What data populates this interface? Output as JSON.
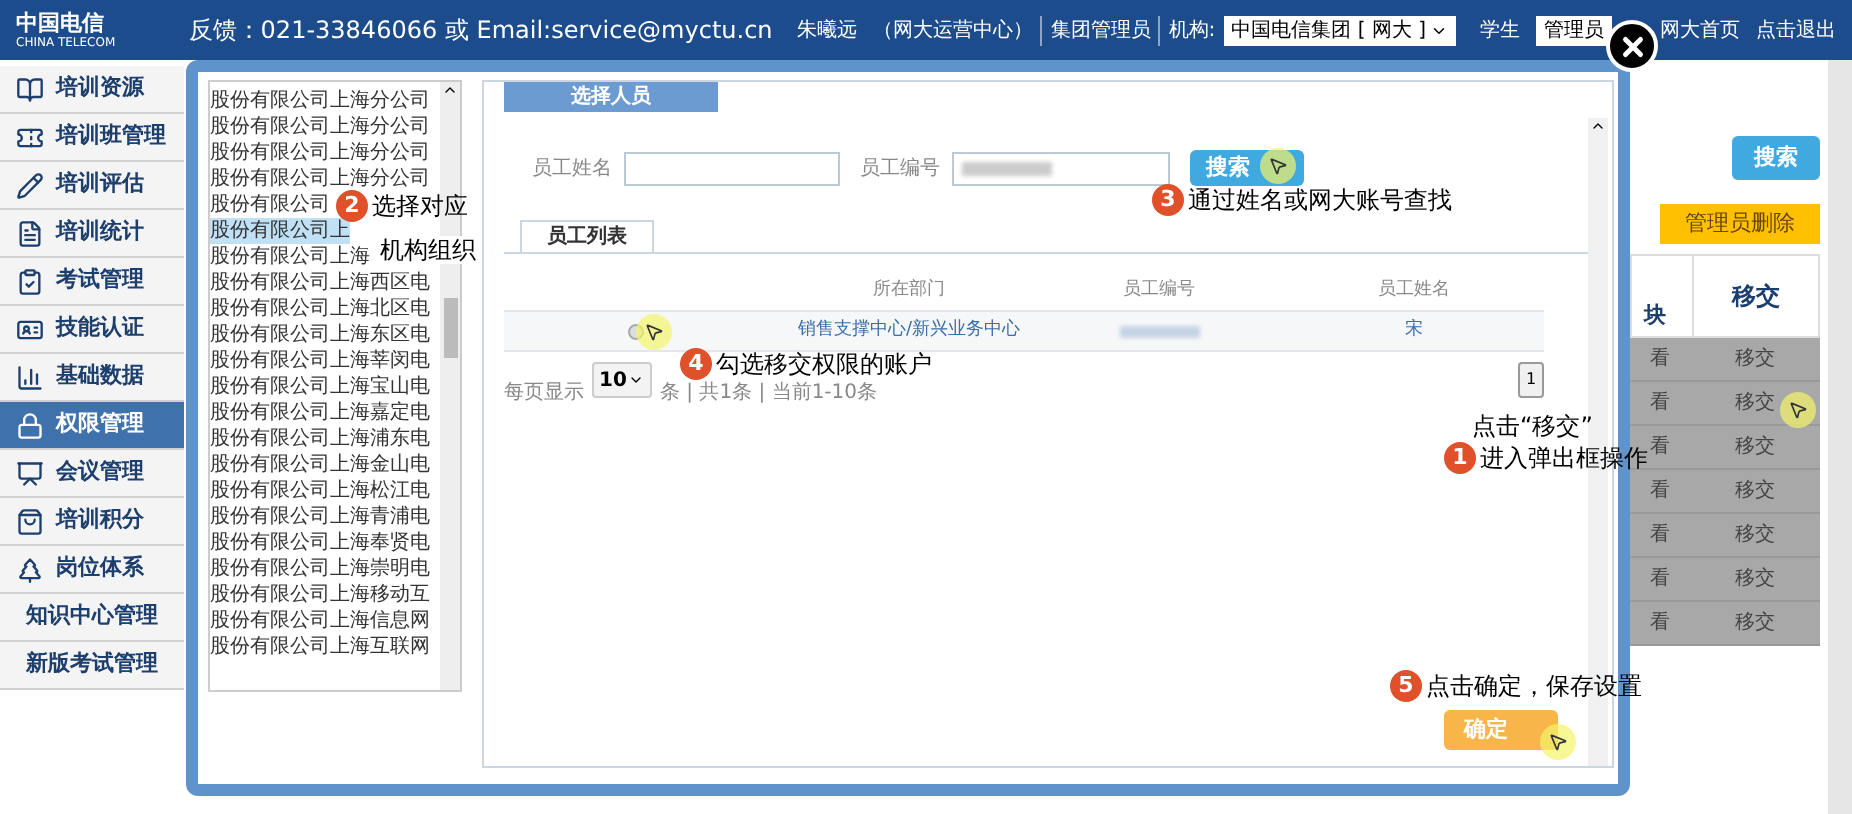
{
  "header": {
    "logo_cn": "中国电信",
    "logo_en": "CHINA TELECOM",
    "feedback": "反馈：021-33846066 或 Email:service@myctu.cn",
    "user": "朱曦远",
    "org_unit": "（网大运营中心）",
    "role": "集团管理员",
    "org_label": "机构:",
    "org_select": "中国电信集团 [ 网大 ]",
    "modes": [
      {
        "label": "学生",
        "selected": false
      },
      {
        "label": "管理员",
        "selected": true
      }
    ],
    "links": [
      "网大首页",
      "点击退出"
    ]
  },
  "sidebar": {
    "items": [
      {
        "label": "培训资源",
        "selected": false
      },
      {
        "label": "培训班管理",
        "selected": false
      },
      {
        "label": "培训评估",
        "selected": false
      },
      {
        "label": "培训统计",
        "selected": false
      },
      {
        "label": "考试管理",
        "selected": false
      },
      {
        "label": "技能认证",
        "selected": false
      },
      {
        "label": "基础数据",
        "selected": false
      },
      {
        "label": "权限管理",
        "selected": true
      },
      {
        "label": "会议管理",
        "selected": false
      },
      {
        "label": "培训积分",
        "selected": false
      },
      {
        "label": "岗位体系",
        "selected": false
      },
      {
        "label": "知识中心管理",
        "selected": false
      },
      {
        "label": "新版考试管理",
        "selected": false
      }
    ]
  },
  "background": {
    "search_button": "搜索",
    "delete_button": "管理员删除",
    "columns": [
      "块",
      "移交"
    ],
    "rows": [
      [
        "看",
        "移交"
      ],
      [
        "看",
        "移交"
      ],
      [
        "看",
        "移交"
      ],
      [
        "看",
        "移交"
      ],
      [
        "看",
        "移交"
      ],
      [
        "看",
        "移交"
      ],
      [
        "看",
        "移交"
      ]
    ]
  },
  "dialog": {
    "org_list": [
      {
        "label": "股份有限公司上海分公司",
        "selected": false
      },
      {
        "label": "股份有限公司上海分公司",
        "selected": false
      },
      {
        "label": "股份有限公司上海分公司",
        "selected": false
      },
      {
        "label": "股份有限公司上海分公司",
        "selected": false
      },
      {
        "label": "股份有限公司",
        "selected": false
      },
      {
        "label": "股份有限公司上",
        "selected": true
      },
      {
        "label": "股份有限公司上海",
        "selected": false
      },
      {
        "label": "股份有限公司上海西区电",
        "selected": false
      },
      {
        "label": "股份有限公司上海北区电",
        "selected": false
      },
      {
        "label": "股份有限公司上海东区电",
        "selected": false
      },
      {
        "label": "股份有限公司上海莘闵电",
        "selected": false
      },
      {
        "label": "股份有限公司上海宝山电",
        "selected": false
      },
      {
        "label": "股份有限公司上海嘉定电",
        "selected": false
      },
      {
        "label": "股份有限公司上海浦东电",
        "selected": false
      },
      {
        "label": "股份有限公司上海金山电",
        "selected": false
      },
      {
        "label": "股份有限公司上海松江电",
        "selected": false
      },
      {
        "label": "股份有限公司上海青浦电",
        "selected": false
      },
      {
        "label": "股份有限公司上海奉贤电",
        "selected": false
      },
      {
        "label": "股份有限公司上海崇明电",
        "selected": false
      },
      {
        "label": "股份有限公司上海移动互",
        "selected": false
      },
      {
        "label": "股份有限公司上海信息网",
        "selected": false
      },
      {
        "label": "股份有限公司上海互联网",
        "selected": false
      }
    ],
    "tab": "选择人员",
    "name_label": "员工姓名",
    "id_label": "员工编号",
    "search_button": "搜索",
    "list_tab": "员工列表",
    "columns": [
      "所在部门",
      "员工编号",
      "员工姓名"
    ],
    "rows": [
      {
        "selected": false,
        "department": "销售支撑中心/新兴业务中心",
        "name": "宋"
      }
    ],
    "per_page_label": "每页显示",
    "per_page": "10",
    "pager_info": "条 | 共1条 | 当前1-10条",
    "pages": [
      {
        "label": "1",
        "selected": true
      }
    ],
    "confirm_button": "确定"
  },
  "annotations": [
    {
      "number": "1",
      "lines": [
        "点击“移交”",
        "进入弹出框操作"
      ]
    },
    {
      "number": "2",
      "lines": [
        "选择对应",
        "机构组织"
      ]
    },
    {
      "number": "3",
      "lines": [
        "通过姓名或网大账号查找"
      ]
    },
    {
      "number": "4",
      "lines": [
        "勾选移交权限的账户"
      ]
    },
    {
      "number": "5",
      "lines": [
        "点击确定，保存设置"
      ]
    }
  ]
}
